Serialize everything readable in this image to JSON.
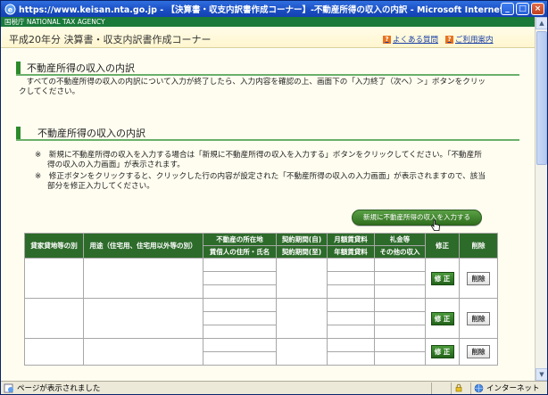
{
  "window": {
    "title": "https://www.keisan.nta.go.jp - 【決算書・収支内訳書作成コーナー】-不動産所得の収入の内訳 - Microsoft Internet Explorer",
    "min": "_",
    "max": "□",
    "close": "×"
  },
  "agency": "国税庁 NATIONAL TAX AGENCY",
  "header": {
    "site_title": "平成20年分 決算書・収支内訳書作成コーナー",
    "faq_label": "よくある質問",
    "guide_label": "ご利用案内",
    "faq_icon": "?",
    "guide_icon": "?"
  },
  "section1": {
    "title": "不動産所得の収入の内訳",
    "description_1": "　すべての不動産所得の収入の内訳について入力が終了したら、入力内容を確認の上、画面下の「入力終了（次へ）＞」ボタンをクリッ",
    "description_2": "クしてください。"
  },
  "section2": {
    "title": "不動産所得の収入の内訳",
    "note1_line1": "※　新規に不動産所得の収入を入力する場合は「新規に不動産所得の収入を入力する」ボタンをクリックしてください。「不動産所",
    "note1_line2": "得の収入の入力画面」が表示されます。",
    "note2_line1": "※　修正ボタンをクリックすると、クリックした行の内容が設定された「不動産所得の収入の入力画面」が表示されますので、該当",
    "note2_line2": "部分を修正入力してください。",
    "new_button": "新規に不動産所得の収入を入力する"
  },
  "table": {
    "headers": {
      "col1": "貸家貸地等の別",
      "col2": "用途（住宅用、住宅用以外等の別）",
      "col3_top": "不動産の所在地",
      "col3_bottom": "賃借人の住所・氏名",
      "col4_top": "契約期間(自)",
      "col4_bottom": "契約期間(至)",
      "col5_top": "月額賃貸料",
      "col5_bottom": "年額賃貸料",
      "col6_top": "礼金等",
      "col6_bottom": "その他の収入",
      "col7": "修正",
      "col8": "削除"
    },
    "edit_label": "修 正",
    "delete_label": "削除"
  },
  "status": {
    "text": "ページが表示されました",
    "zone": "インターネット"
  }
}
